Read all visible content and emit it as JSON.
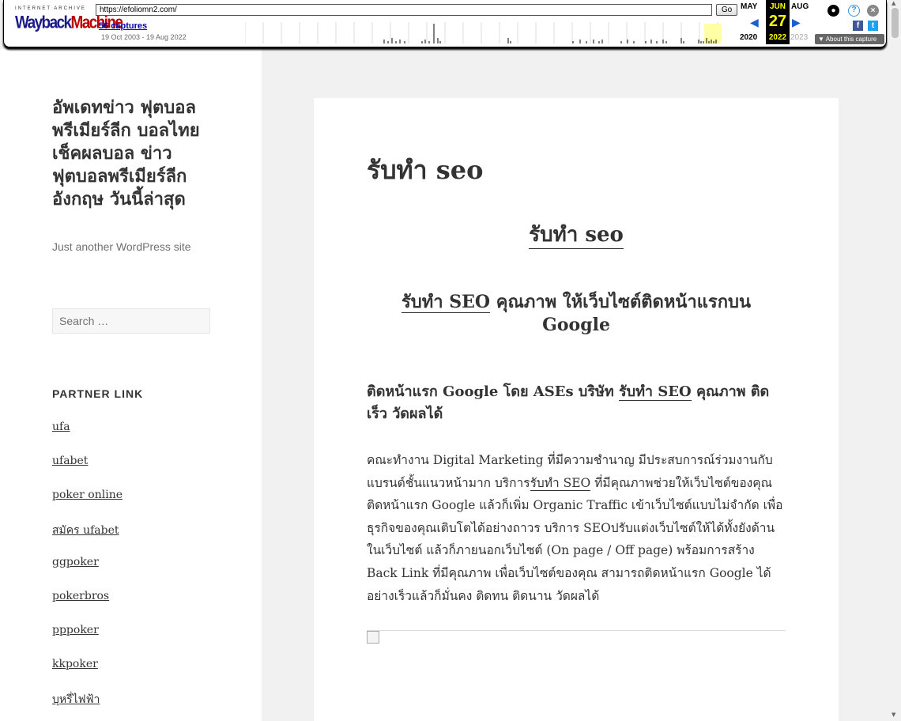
{
  "wayback": {
    "logo_top": "INTERNET ARCHIVE",
    "logo_main_a": "Wayback",
    "logo_main_b": "Machine",
    "url": "https://efoliomn2.com/",
    "go_label": "Go",
    "captures": "56 captures",
    "range": "19 Oct 2003 - 19 Aug 2022",
    "prev_month": "MAY",
    "cur_month": "JUN",
    "next_month": "AUG",
    "cur_day": "27",
    "prev_year": "2020",
    "cur_year": "2022",
    "next_year": "2023",
    "about": "About this capture",
    "facebook": "f",
    "twitter": "t",
    "help": "?",
    "close": "×"
  },
  "sidebar": {
    "site_title": "อัพเดทข่าว ฟุตบอลพรีเมียร์ลีก บอลไทย เช็คผลบอล ข่าวฟุตบอลพรีเมียร์ลีก อังกฤษ วันนี้ล่าสุด",
    "tagline": "Just another WordPress site",
    "search_placeholder": "Search …",
    "widget_title": "PARTNER LINK",
    "links": [
      "ufa",
      "ufabet",
      "poker online",
      "สมัคร ufabet",
      "ggpoker",
      "pokerbros",
      "pppoker",
      "kkpoker",
      "บุหรี่ไฟฟ้า"
    ]
  },
  "article": {
    "title": "รับทำ seo",
    "h1": "รับทำ seo",
    "h2_link": "รับทำ SEO",
    "h2_rest": " คุณภาพ ให้เว็บไซต์ติดหน้าแรกบน Google",
    "h3_a": "ติดหน้าแรก Google โดย ASEs บริษัท ",
    "h3_link": "รับทำ SEO",
    "h3_b": " คุณภาพ ติดเร็ว วัดผลได้",
    "p_a": "คณะทำงาน Digital Marketing ที่มีความชำนาญ มีประสบการณ์ร่วมงานกับแบรนด์ชั้นแนวหน้ามาก บริการ",
    "p_link": "รับทำ SEO",
    "p_b": " ที่มีคุณภาพช่วยให้เว็บไซต์ของคุณติดหน้าแรก Google แล้วก็เพิ่ม Organic Traffic เข้าเว็บไซต์แบบไม่จำกัด เพื่อธุรกิจของคุณเติบโตได้อย่างถาวร บริการ SEOปรับแต่งเว็บไซต์ให้ได้ทั้งยังด้านในเว็บไซต์ แล้วก็ภายนอกเว็บไซต์ (On page / Off page) พร้อมการสร้าง Back Link ที่มีคุณภาพ เพื่อเว็บไซต์ของคุณ สามารถติดหน้าแรก Google ได้อย่างเร็วแล้วก็มั่นคง ติดทน ติดนาน วัดผลได้"
  }
}
